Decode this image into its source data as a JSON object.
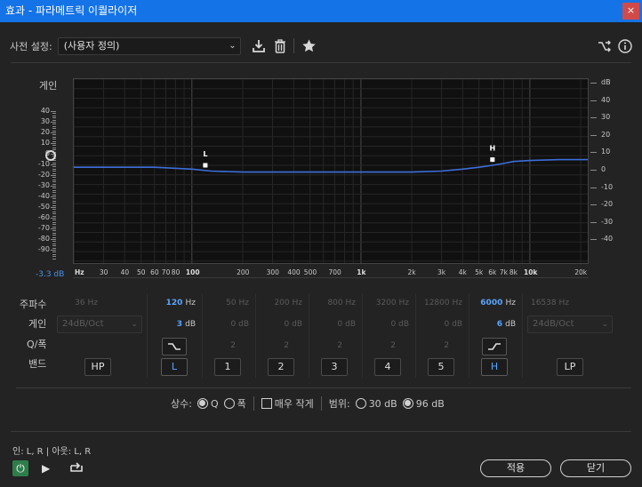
{
  "window": {
    "title": "효과 - 파라메트릭 이퀄라이저",
    "close": "×"
  },
  "preset": {
    "label": "사전 설정:",
    "value": "(사용자 정의)"
  },
  "graph": {
    "gain_label": "게인",
    "left_ticks": [
      "40",
      "30",
      "20",
      "10",
      "0",
      "-10",
      "-20",
      "-30",
      "-40",
      "-50",
      "-60",
      "-70",
      "-80",
      "-90"
    ],
    "right_ticks": [
      "dB",
      "40",
      "30",
      "20",
      "10",
      "0",
      "-10",
      "-20",
      "-30",
      "-40"
    ],
    "freq_ticks": [
      "Hz",
      "30",
      "40",
      "50",
      "60",
      "70",
      "80",
      "100",
      "200",
      "300",
      "400",
      "500",
      "700",
      "1k",
      "2k",
      "3k",
      "4k",
      "5k",
      "6k",
      "7k",
      "8k",
      "10k",
      "20k"
    ],
    "master_gain": "-3.3 dB",
    "markers": {
      "low": "L",
      "high": "H"
    }
  },
  "chart_data": {
    "type": "line",
    "xscale": "log",
    "xlabel": "Hz",
    "ylabel": "dB",
    "xlim": [
      20,
      22000
    ],
    "ylim": [
      -48,
      48
    ],
    "series": [
      {
        "values": [
          [
            20,
            2
          ],
          [
            60,
            2
          ],
          [
            100,
            1
          ],
          [
            130,
            0
          ],
          [
            200,
            -0.5
          ],
          [
            500,
            -0.5
          ],
          [
            1000,
            -0.5
          ],
          [
            2000,
            -0.5
          ],
          [
            3000,
            0
          ],
          [
            4000,
            1
          ],
          [
            5000,
            2
          ],
          [
            6000,
            3
          ],
          [
            7000,
            4
          ],
          [
            8000,
            5
          ],
          [
            10000,
            5.5
          ],
          [
            15000,
            6
          ],
          [
            22000,
            6
          ]
        ]
      }
    ],
    "markers": [
      {
        "label": "L",
        "x": 120,
        "y": 3
      },
      {
        "label": "H",
        "x": 6000,
        "y": 6
      }
    ]
  },
  "bands": {
    "labels": {
      "freq": "주파수",
      "gain": "게인",
      "q": "Q/폭",
      "band": "밴드"
    },
    "hp": {
      "freq": "36",
      "unit": "Hz",
      "slope": "24dB/Oct",
      "button": "HP"
    },
    "l": {
      "freq": "120",
      "unit": "Hz",
      "gain": "3",
      "gain_unit": "dB",
      "button": "L"
    },
    "b1": {
      "freq": "50",
      "unit": "Hz",
      "gain": "0",
      "gain_unit": "dB",
      "q": "2",
      "button": "1"
    },
    "b2": {
      "freq": "200",
      "unit": "Hz",
      "gain": "0",
      "gain_unit": "dB",
      "q": "2",
      "button": "2"
    },
    "b3": {
      "freq": "800",
      "unit": "Hz",
      "gain": "0",
      "gain_unit": "dB",
      "q": "2",
      "button": "3"
    },
    "b4": {
      "freq": "3200",
      "unit": "Hz",
      "gain": "0",
      "gain_unit": "dB",
      "q": "2",
      "button": "4"
    },
    "b5": {
      "freq": "12800",
      "unit": "Hz",
      "gain": "0",
      "gain_unit": "dB",
      "q": "2",
      "button": "5"
    },
    "h": {
      "freq": "6000",
      "unit": "Hz",
      "gain": "6",
      "gain_unit": "dB",
      "button": "H"
    },
    "lp": {
      "freq": "16538",
      "unit": "Hz",
      "slope": "24dB/Oct",
      "button": "LP"
    }
  },
  "options": {
    "constant_label": "상수:",
    "q_label": "Q",
    "width_label": "폭",
    "ultra_label": "매우 작게",
    "range_label": "범위:",
    "range30": "30 dB",
    "range96": "96 dB"
  },
  "footer": {
    "io": "인: L, R | 아웃: L, R",
    "apply": "적용",
    "close": "닫기"
  }
}
